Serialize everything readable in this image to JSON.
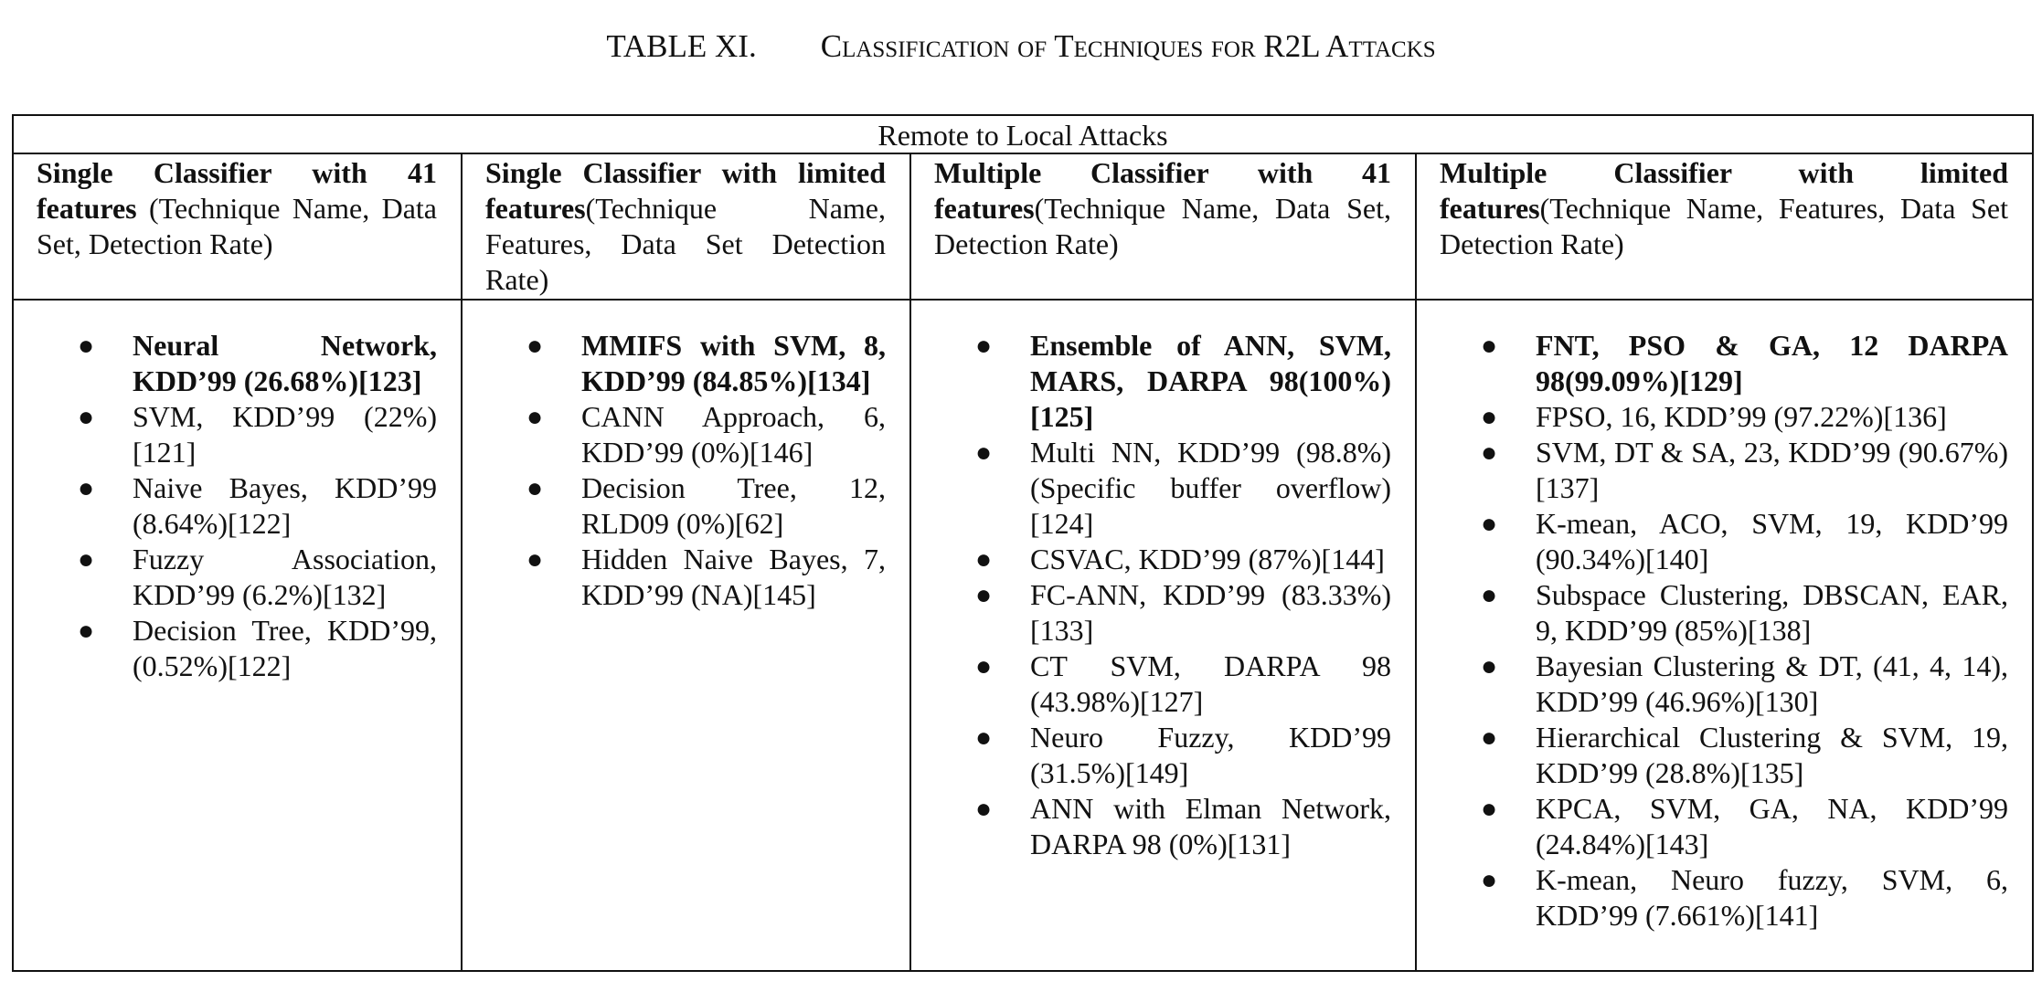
{
  "caption": {
    "label": "TABLE XI.",
    "title": "Classification of Techniques for R2L Attacks"
  },
  "table": {
    "span_header": "Remote to Local Attacks",
    "columns": [
      {
        "head_bold": "Single Classifier with 41 features",
        "head_rest": " (Technique Name, Data Set, Detection Rate)",
        "items": [
          "Neural Network, KDD’99 (26.68%)[123]",
          "SVM, KDD’99 (22%)[121]",
          "Naive Bayes, KDD’99 (8.64%)[122]",
          "Fuzzy Association, KDD’99 (6.2%)[132]",
          "Decision Tree, KDD’99, (0.52%)[122]"
        ]
      },
      {
        "head_bold": "Single Classifier with limited features",
        "head_rest": "(Technique Name, Features, Data Set Detection Rate)",
        "items": [
          "MMIFS with SVM, 8, KDD’99 (84.85%)[134]",
          "CANN Approach, 6, KDD’99 (0%)[146]",
          "Decision Tree, 12, RLD09 (0%)[62]",
          "Hidden Naive Bayes, 7, KDD’99 (NA)[145]"
        ]
      },
      {
        "head_bold": "Multiple Classifier with 41 features",
        "head_rest": "(Technique Name, Data Set, Detection Rate)",
        "items": [
          "Ensemble of ANN, SVM, MARS, DARPA 98(100%)[125]",
          "Multi NN, KDD’99 (98.8%) (Specific buffer overflow)[124]",
          "CSVAC, KDD’99 (87%)[144]",
          "FC-ANN, KDD’99 (83.33%)[133]",
          "CT SVM, DARPA 98 (43.98%)[127]",
          "Neuro Fuzzy, KDD’99 (31.5%)[149]",
          "ANN with Elman Network, DARPA 98 (0%)[131]"
        ]
      },
      {
        "head_bold": "Multiple Classifier with limited features",
        "head_rest": "(Technique Name, Features, Data Set Detection Rate)",
        "items": [
          "FNT, PSO & GA, 12 DARPA 98(99.09%)[129]",
          "FPSO, 16, KDD’99 (97.22%)[136]",
          "SVM, DT & SA, 23, KDD’99 (90.67%)[137]",
          "K-mean, ACO, SVM, 19, KDD’99 (90.34%)[140]",
          "Subspace Clustering, DBSCAN, EAR, 9, KDD’99 (85%)[138]",
          "Bayesian Clustering & DT, (41, 4, 14), KDD’99 (46.96%)[130]",
          "Hierarchical Clustering & SVM, 19, KDD’99 (28.8%)[135]",
          "KPCA, SVM, GA, NA, KDD’99 (24.84%)[143]",
          "K-mean, Neuro fuzzy, SVM, 6, KDD’99 (7.661%)[141]"
        ]
      }
    ]
  }
}
